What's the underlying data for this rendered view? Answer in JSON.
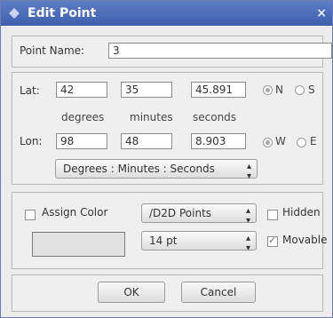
{
  "window": {
    "title": "Edit Point",
    "close_icon": "×"
  },
  "point_name": {
    "label": "Point Name:",
    "value": "3"
  },
  "lat": {
    "label": "Lat:",
    "degrees": "42",
    "minutes": "35",
    "seconds": "45.891",
    "hemisphere_options": [
      "N",
      "S"
    ],
    "hemisphere_selected": "N"
  },
  "units": {
    "degrees": "degrees",
    "minutes": "minutes",
    "seconds": "seconds"
  },
  "lon": {
    "label": "Lon:",
    "degrees": "98",
    "minutes": "48",
    "seconds": "8.903",
    "hemisphere_options": [
      "W",
      "E"
    ],
    "hemisphere_selected": "W"
  },
  "format_select": {
    "value": "Degrees : Minutes : Seconds"
  },
  "style": {
    "assign_color_label": "Assign Color",
    "assign_color_checked": false,
    "symbol_select": "/D2D Points",
    "size_select": "14 pt",
    "hidden_label": "Hidden",
    "hidden_checked": false,
    "movable_label": "Movable",
    "movable_checked": true
  },
  "buttons": {
    "ok": "OK",
    "cancel": "Cancel"
  },
  "colors": {
    "title_bar": "#4a6bb8",
    "dialog_bg": "#ececec"
  }
}
